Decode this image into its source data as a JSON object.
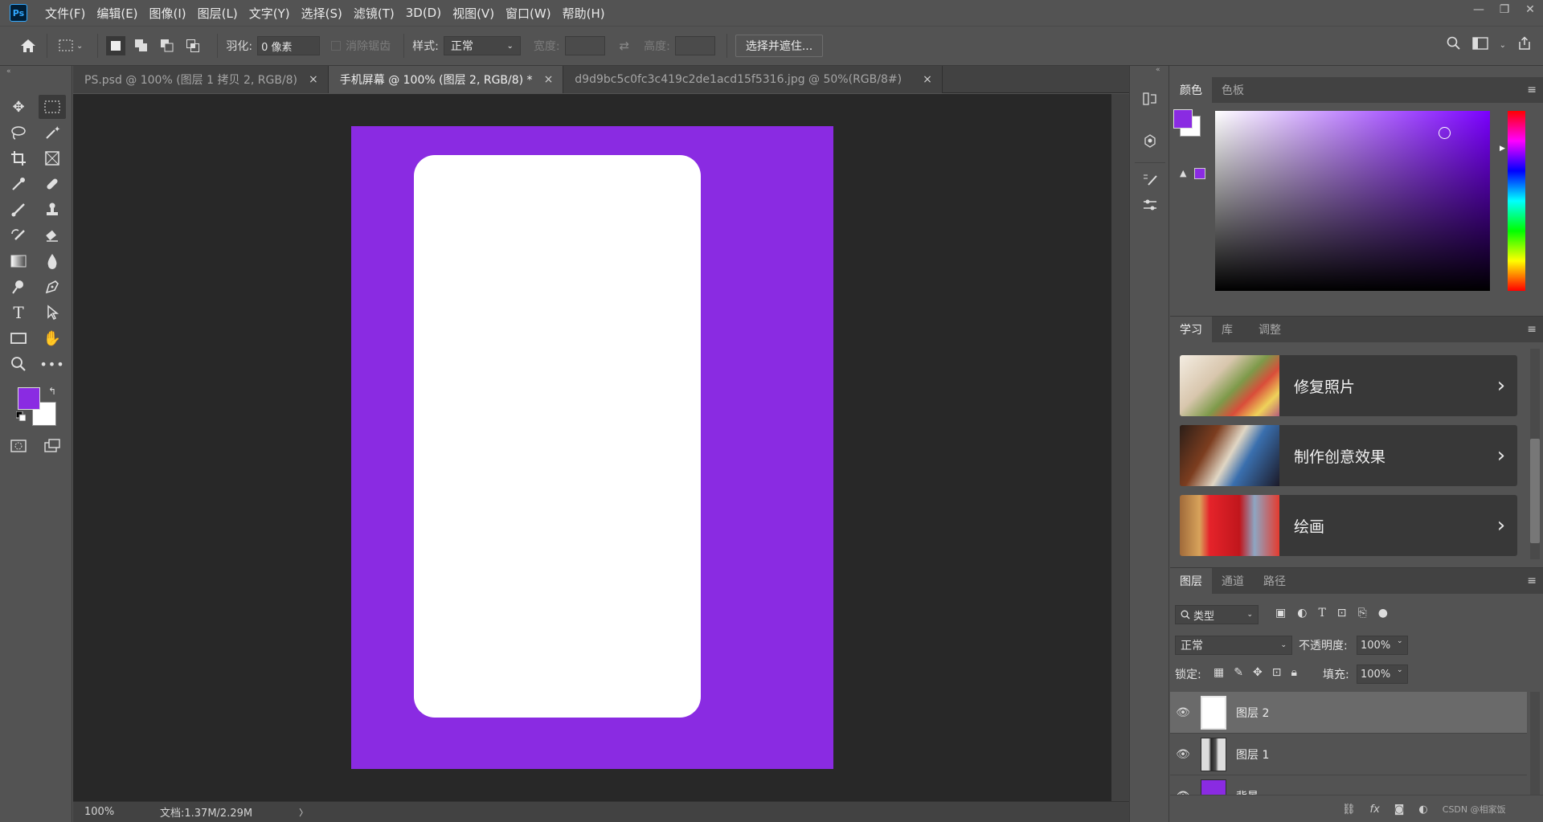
{
  "app": {
    "logo": "Ps"
  },
  "menu": [
    "文件(F)",
    "编辑(E)",
    "图像(I)",
    "图层(L)",
    "文字(Y)",
    "选择(S)",
    "滤镜(T)",
    "3D(D)",
    "视图(V)",
    "窗口(W)",
    "帮助(H)"
  ],
  "window_controls": {
    "minimize": "—",
    "restore": "❐",
    "close": "✕"
  },
  "options": {
    "feather_label": "羽化:",
    "feather_value": "0 像素",
    "antialias_label": "消除锯齿",
    "style_label": "样式:",
    "style_value": "正常",
    "width_label": "宽度:",
    "height_label": "高度:",
    "select_mask_button": "选择并遮住..."
  },
  "tabs": [
    {
      "label": "PS.psd @ 100% (图层 1 拷贝 2, RGB/8)",
      "close": "×"
    },
    {
      "label": "手机屏幕 @ 100% (图层 2, RGB/8) *",
      "close": "×"
    },
    {
      "label": "d9d9bc5c0fc3c419c2de1acd15f5316.jpg @ 50%(RGB/8#)",
      "close": "×"
    }
  ],
  "canvas": {
    "artboard_color": "#8a2be2",
    "screen_color": "#ffffff"
  },
  "status": {
    "zoom": "100%",
    "doc": "文档:1.37M/2.29M",
    "arrow": "〉"
  },
  "colors": {
    "foreground": "#8a2be2",
    "background": "#ffffff"
  },
  "color_panel": {
    "tabs": [
      "颜色",
      "色板"
    ]
  },
  "learn_panel": {
    "tabs": [
      "学习",
      "库",
      "调整"
    ],
    "cards": [
      {
        "title": "修复照片"
      },
      {
        "title": "制作创意效果"
      },
      {
        "title": "绘画"
      }
    ]
  },
  "layers_panel": {
    "tabs": [
      "图层",
      "通道",
      "路径"
    ],
    "filter_label": "类型",
    "blend_mode": "正常",
    "opacity_label": "不透明度:",
    "opacity_value": "100%",
    "lock_label": "锁定:",
    "fill_label": "填充:",
    "fill_value": "100%",
    "layers": [
      {
        "name": "图层 2",
        "selected": true
      },
      {
        "name": "图层 1",
        "selected": false
      },
      {
        "name": "背景",
        "selected": false
      }
    ],
    "footer_text": "CSDN @相家饭"
  }
}
